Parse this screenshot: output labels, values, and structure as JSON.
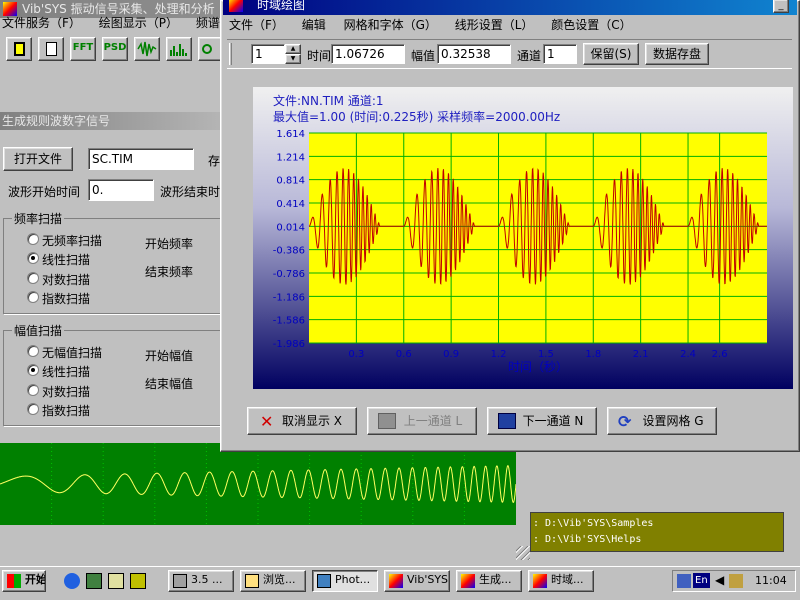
{
  "bg_app": {
    "title": "Vib'SYS 振动信号采集、处理和分析",
    "menu": [
      "文件服务（F）",
      "绘图显示（P）",
      "频谱分析（A"
    ],
    "toolbar": [
      "FFT",
      "PSD"
    ]
  },
  "gen_panel": {
    "title": "生成规则波数字信号",
    "open_button": "打开文件",
    "filename": "SC.TIM",
    "save_partial": "存",
    "start_time_label": "波形开始时间",
    "start_time_value": "0.",
    "end_time_label": "波形结束时",
    "freq_group": "频率扫描",
    "freq_options": [
      "无频率扫描",
      "线性扫描",
      "对数扫描",
      "指数扫描"
    ],
    "freq_selected": 1,
    "start_freq_label": "开始频率",
    "end_freq_label": "结束频率",
    "amp_group": "幅值扫描",
    "amp_options": [
      "无幅值扫描",
      "线性扫描",
      "对数扫描",
      "指数扫描"
    ],
    "amp_selected": 1,
    "start_amp_label": "开始幅值",
    "end_amp_label": "结束幅值"
  },
  "info_panel": {
    "lines": [
      ": D:\\Vib'SYS\\Samples",
      ": D:\\Vib'SYS\\Helps"
    ]
  },
  "td_window": {
    "title": "时域绘图",
    "menu": [
      "文件（F）",
      "编辑",
      "网格和字体（G）",
      "线形设置（L）",
      "颜色设置（C）"
    ],
    "spin_value": "1",
    "time_label": "时间",
    "time_value": "1.06726",
    "amp_label": "幅值",
    "amp_value": "0.32538",
    "channel_label": "通道",
    "channel_value": "1",
    "keep_button": "保留(S)",
    "save_button": "数据存盘",
    "cancel_button": "取消显示 X",
    "prev_button": "上一通道 L",
    "next_button": "下一通道 N",
    "grid_button": "设置网格 G"
  },
  "chart_data": {
    "type": "line",
    "info_line1": "文件:NN.TIM 通道:1",
    "info_line2": "最大值=1.00 (时间:0.225秒) 采样频率=2000.00Hz",
    "xlabel": "时间（秒）",
    "xlim": [
      0,
      2.9
    ],
    "ylim": [
      -1.986,
      1.614
    ],
    "xticks": [
      "0.3",
      "0.6",
      "0.9",
      "1.2",
      "1.5",
      "1.8",
      "2.1",
      "2.4",
      "2.6"
    ],
    "yticks": [
      "1.614",
      "1.214",
      "0.814",
      "0.414",
      "0.014",
      "-0.386",
      "-0.786",
      "-1.186",
      "-1.586",
      "-1.986"
    ],
    "grid": true,
    "burst_period": 0.6,
    "burst_duration": 0.45,
    "burst_freq_hz": 20,
    "amplitude": 1.0,
    "baseline": 0.014,
    "line_color": "#c00000",
    "plot_bg": "#ffff00",
    "grid_color": "#00b000"
  },
  "bottom_wave": {
    "type": "line",
    "line_color": "#ffff60",
    "bg": "#008000",
    "grid_color": "#00c000",
    "f0": 4,
    "f1": 48,
    "amplitude": 0.5
  },
  "taskbar": {
    "start": "开始",
    "tasks": [
      "3.5 ...",
      "浏览...",
      "Phot...",
      "Vib'SYS",
      "生成...",
      "时域..."
    ],
    "active_task": 2,
    "tray_lang": "En",
    "clock": "11:04"
  }
}
